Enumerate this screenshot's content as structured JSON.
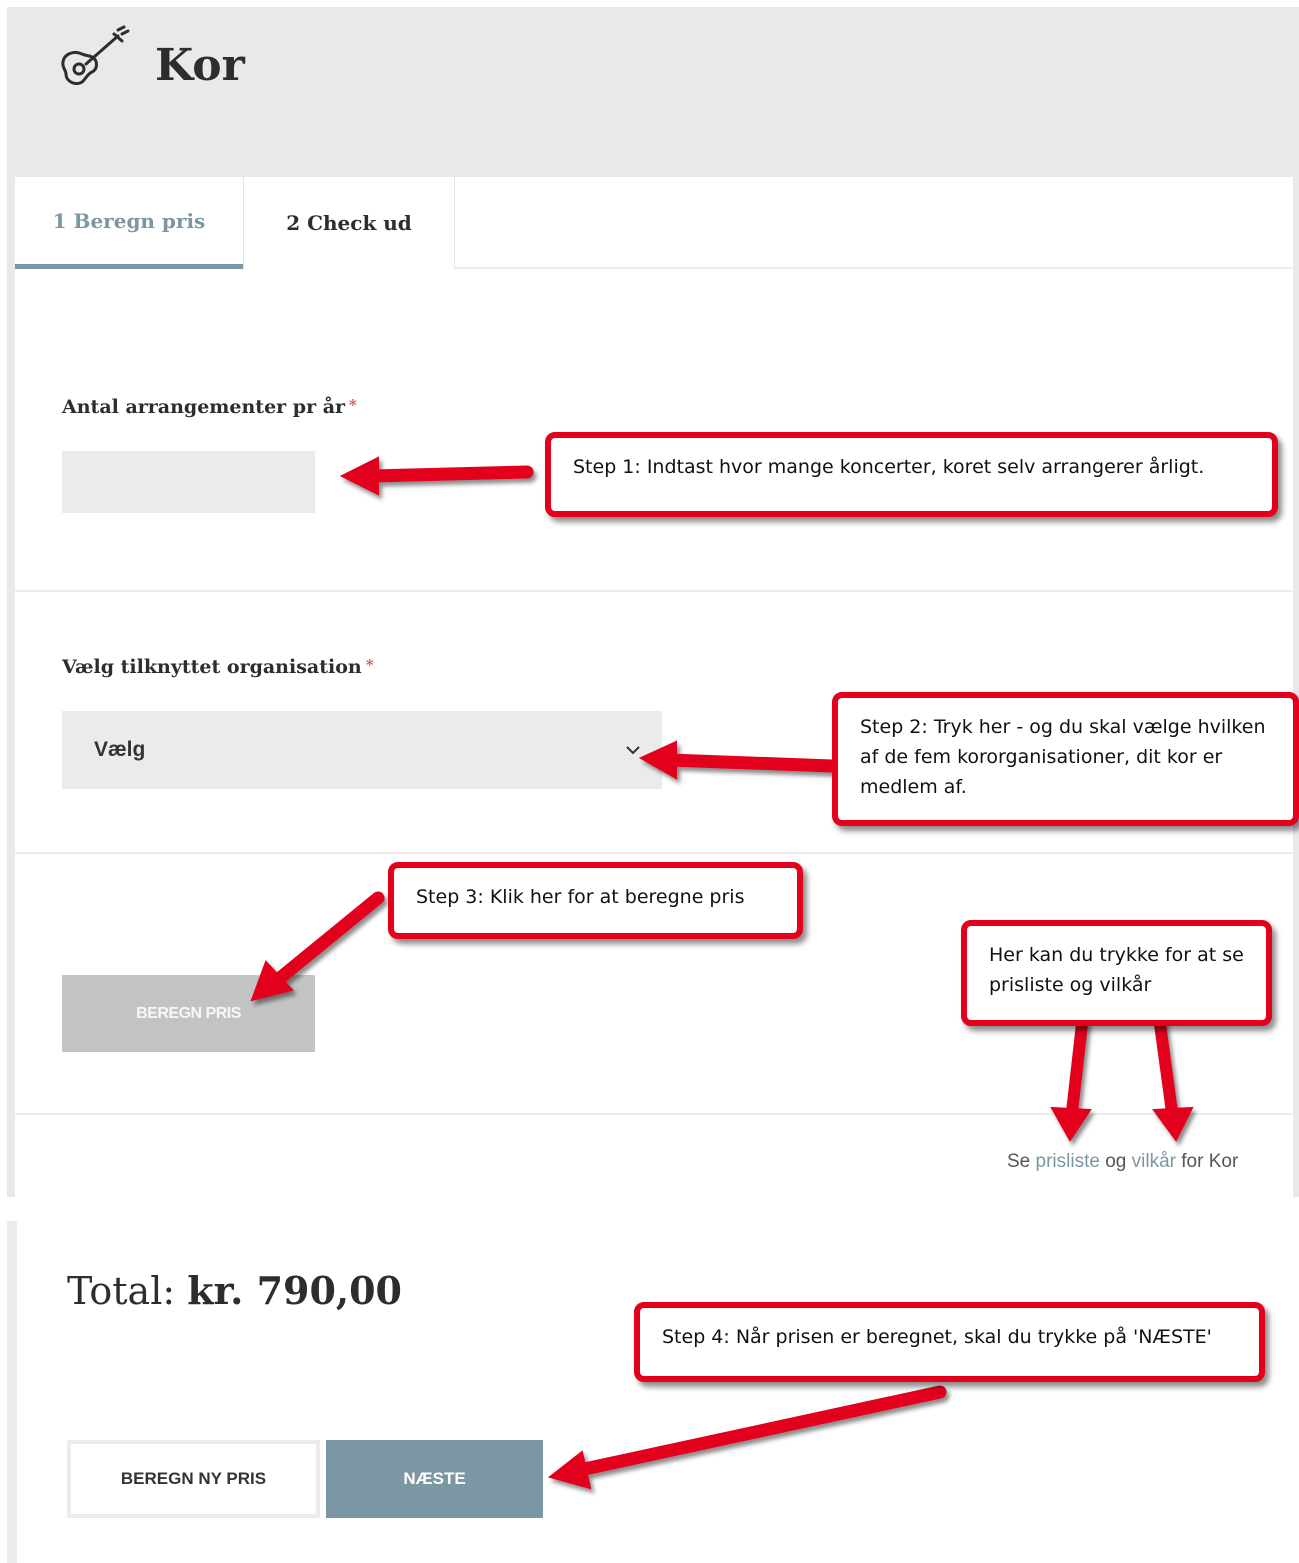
{
  "header": {
    "title": "Kor",
    "icon": "guitar-icon"
  },
  "tabs": [
    {
      "label": "1 Beregn pris",
      "active": true
    },
    {
      "label": "2 Check ud",
      "active": false
    }
  ],
  "form": {
    "events_label": "Antal arrangementer pr år",
    "events_value": "",
    "org_label": "Vælg tilknyttet organisation",
    "org_selected": "Vælg",
    "required_mark": "*",
    "calc_button": "BEREGN PRIS"
  },
  "links": {
    "prefix": "Se",
    "pricelist": "prisliste",
    "and": "og",
    "terms": "vilkår",
    "suffix": "for Kor"
  },
  "summary": {
    "total_label": "Total:",
    "total_value": "kr. 790,00",
    "recalc_button": "BEREGN NY PRIS",
    "next_button": "NÆSTE"
  },
  "callouts": {
    "step1": "Step 1: Indtast hvor mange koncerter, koret selv arrangerer årligt.",
    "step2": "Step 2: Tryk her - og du skal vælge hvilken af de fem kororganisationer, dit kor er medlem af.",
    "step3": "Step 3: Klik her for at beregne pris",
    "links_hint": "Her kan du trykke for at se prisliste og vilkår",
    "step4": "Step 4: Når prisen er beregnet, skal du trykke på 'NÆSTE'"
  },
  "colors": {
    "accent": "#7b97a4",
    "annotation_red": "#e3001b",
    "field_bg": "#ebebeb",
    "header_bg": "#e9e9e9"
  }
}
